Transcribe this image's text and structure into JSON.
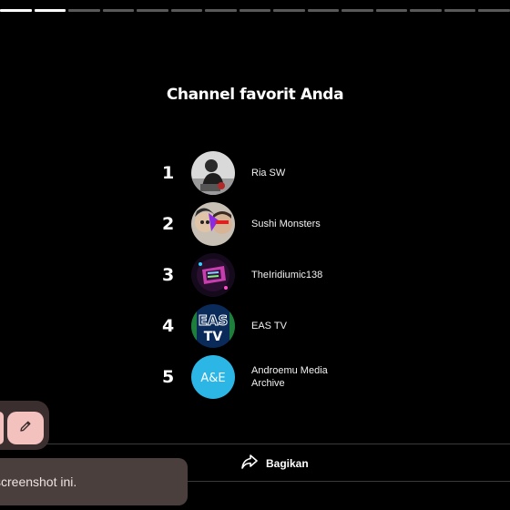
{
  "progress": {
    "total": 15,
    "active": [
      0,
      1
    ]
  },
  "title": "Channel favorit Anda",
  "channels": [
    {
      "rank": "1",
      "name": "Ria SW",
      "avatar_icon": "person-photo-avatar"
    },
    {
      "rank": "2",
      "name": "Sushi Monsters",
      "avatar_icon": "two-people-photo-avatar"
    },
    {
      "rank": "3",
      "name": "TheIridiumic138",
      "avatar_icon": "neon-logo-avatar"
    },
    {
      "rank": "4",
      "name": "EAS TV",
      "avatar_icon": "eas-tv-logo-avatar"
    },
    {
      "rank": "5",
      "name": "Androemu Media Archive",
      "avatar_icon": "ae-logo-avatar"
    }
  ],
  "share": {
    "label": "Bagikan",
    "icon": "share-arrow-icon"
  },
  "toolbar": {
    "edit_icon": "pencil-icon"
  },
  "toast": {
    "text": "screenshot ini."
  },
  "colors": {
    "background": "#000000",
    "edit_button": "#f3c2bf",
    "toast_bg": "#4a3f3d",
    "ae_logo": "#2bb6e6"
  }
}
